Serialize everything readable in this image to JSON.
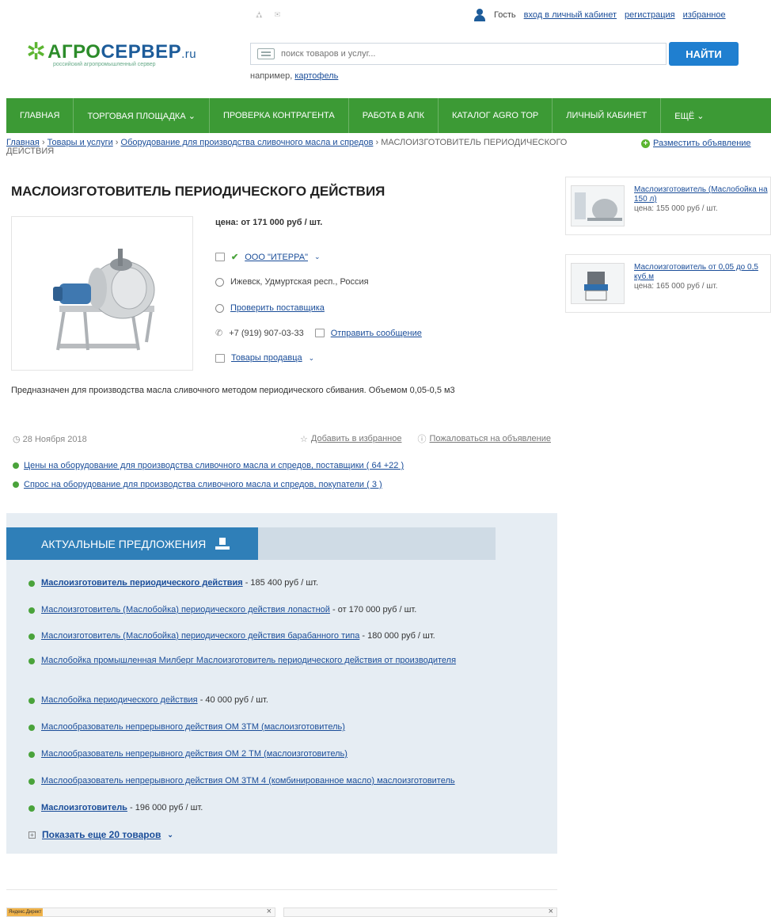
{
  "header": {
    "top_icons": "⛼ ✉",
    "user_name": "Гость",
    "links": [
      "вход в личный кабинет",
      "регистрация",
      "избранное"
    ]
  },
  "logo": {
    "brand_main": "АГРО",
    "brand_accent": "СЕРВЕР",
    "brand_tld": ".ru",
    "tagline": "российский агропромышленный сервер"
  },
  "search": {
    "placeholder": "поиск товаров и услуг...",
    "button_label": "НАЙТИ",
    "hint_prefix": "например,",
    "hint_link": "картофель"
  },
  "nav": {
    "items": [
      "ГЛАВНАЯ",
      "ТОРГОВАЯ ПЛОЩАДКА ⌄",
      "ПРОВЕРКА КОНТРАГЕНТА",
      "РАБОТА В АПК",
      "КАТАЛОГ AGRO TOP",
      "ЛИЧНЫЙ КАБИНЕТ",
      "ЕЩЁ ⌄"
    ]
  },
  "breadcrumb": {
    "items": [
      "Главная",
      "Товары и услуги",
      "Оборудование для производства сливочного масла и спредов"
    ],
    "separator": "›",
    "current": "МАСЛОИЗГОТОВИТЕЛЬ ПЕРИОДИЧЕСКОГО ДЕЙСТВИЯ",
    "post_ad": "Разместить объявление"
  },
  "product": {
    "title": "МАСЛОИЗГОТОВИТЕЛЬ ПЕРИОДИЧЕСКОГО ДЕЙСТВИЯ",
    "price": "цена: от 171 000 руб / шт.",
    "seller": "ООО \"ИТЕРРА\"",
    "location": "Ижевск, Удмуртская респ., Россия",
    "check_supplier": "Проверить поставщика",
    "phone": "+7 (919) 907-03-33",
    "send_message": "Отправить сообщение",
    "seller_goods": "Товары продавца",
    "description": "Предназначен для производства масла сливочного методом периодического сбивания. Объемом 0,05-0,5 м3",
    "date": "28 Ноября 2018",
    "add_favorite": "Добавить в избранное",
    "complain": "Пожаловаться на объявление"
  },
  "related_links": [
    "Цены на оборудование для производства сливочного масла и спредов, поставщики ( 64 +22 )",
    "Спрос на оборудование для производства сливочного масла и спредов, покупатели ( 3 )"
  ],
  "offers": {
    "heading": "АКТУАЛЬНЫЕ ПРЕДЛОЖЕНИЯ",
    "items": [
      {
        "link": "Маслоизготовитель периодического действия",
        "rest": " - 185 400 руб / шт."
      },
      {
        "link": "Маслоизготовитель (Маслобойка) периодического действия лопастной",
        "rest": " - от 170 000 руб / шт."
      },
      {
        "link": "Маслоизготовитель (Маслобойка) периодического действия барабанного типа",
        "rest": " - 180 000 руб / шт."
      },
      {
        "link": "Маслобойка промышленная Милберг Маслоизготовитель периодического действия от производителя",
        "rest": ""
      },
      {
        "link": "Маслобойка периодического действия",
        "rest": " - 40 000 руб / шт."
      },
      {
        "link": "Маслообразователь непрерывного действия ОМ 3ТМ (маслоизготовитель)",
        "rest": ""
      },
      {
        "link": "Маслообразователь непрерывного действия ОМ 2 ТМ (маслоизготовитель)",
        "rest": ""
      },
      {
        "link": "Маслообразователь непрерывного действия ОМ 3ТМ 4 (комбинированное масло) маслоизготовитель",
        "rest": ""
      },
      {
        "link": "Маслоизготовитель",
        "rest": " - 196 000 руб / шт."
      }
    ],
    "show_more": "Показать еще 20 товаров"
  },
  "sidebar": [
    {
      "title": "Маслоизготовитель (Маслобойка на 150 л)",
      "price": "цена: 155 000 руб / шт."
    },
    {
      "title": "Маслоизготовитель от 0,05 до 0,5 куб.м",
      "price": "цена: 165 000 руб / шт."
    }
  ],
  "ads": {
    "label": "Яндекс.Директ"
  }
}
